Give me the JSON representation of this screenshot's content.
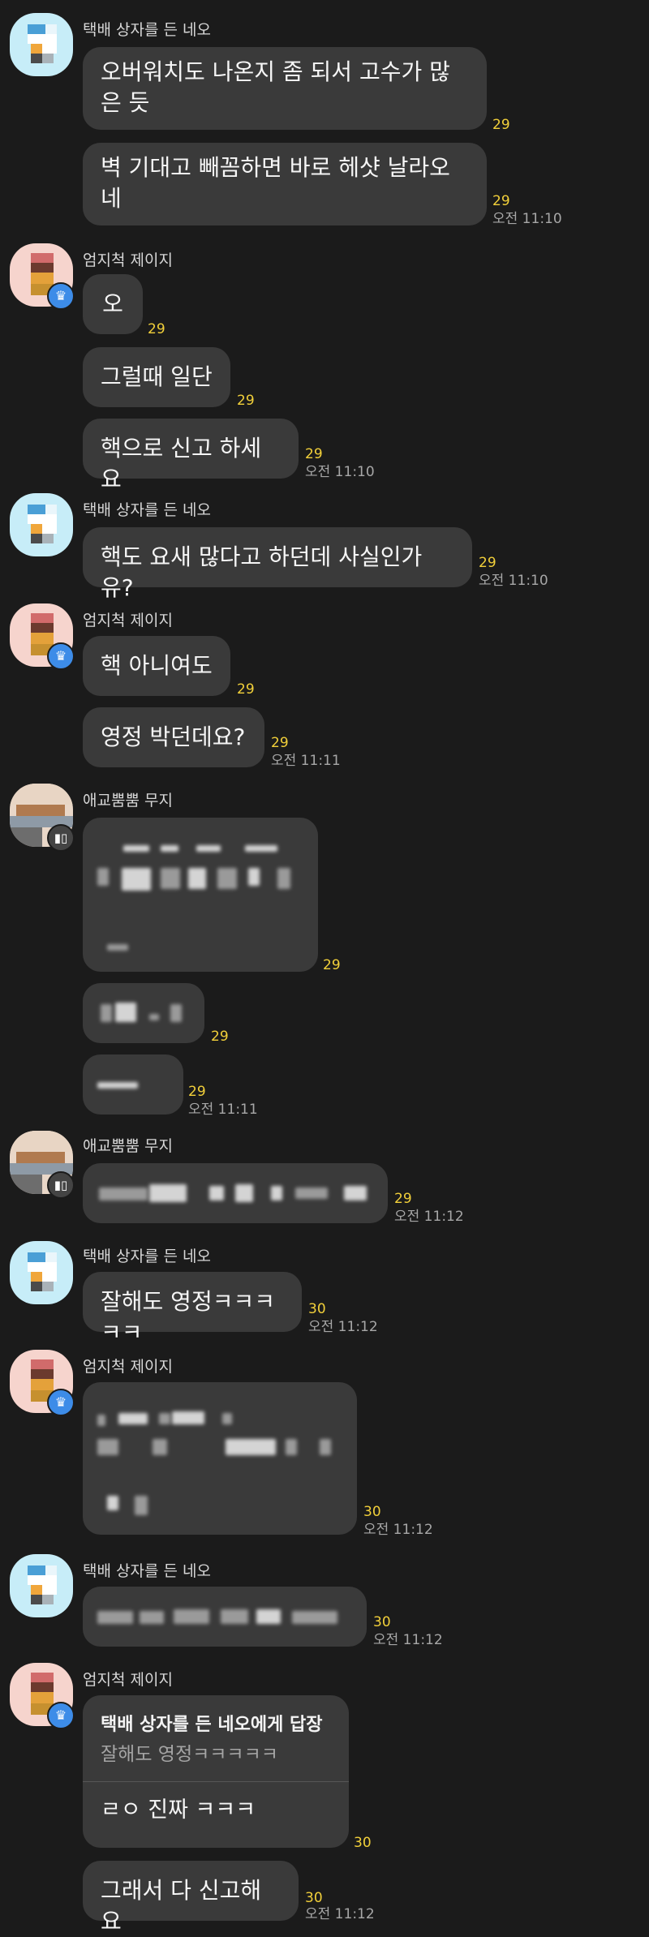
{
  "users": {
    "neo": "택배 상자를 든 네오",
    "jay": "엄지척 제이지",
    "muzi": "애교뿜뿜 무지"
  },
  "messages": [
    {
      "id": "m1",
      "text": "오버워치도 나온지 좀 되서 고수가 많은 듯",
      "count": "29"
    },
    {
      "id": "m2",
      "text": "벽 기대고 빼꼼하면 바로 헤샷 날라오 네",
      "count": "29",
      "time": "오전 11:10"
    },
    {
      "id": "m3",
      "text": "오",
      "count": "29"
    },
    {
      "id": "m4",
      "text": "그럴때 일단",
      "count": "29"
    },
    {
      "id": "m5",
      "text": "핵으로 신고 하세요",
      "count": "29",
      "time": "오전 11:10"
    },
    {
      "id": "m6",
      "text": "핵도 요새 많다고 하던데 사실인가유?",
      "count": "29",
      "time": "오전 11:10"
    },
    {
      "id": "m7",
      "text": "핵 아니여도",
      "count": "29"
    },
    {
      "id": "m8",
      "text": "영정 박던데요?",
      "count": "29",
      "time": "오전 11:11"
    },
    {
      "id": "m9",
      "count": "29"
    },
    {
      "id": "m10",
      "count": "29"
    },
    {
      "id": "m11",
      "count": "29",
      "time": "오전 11:11"
    },
    {
      "id": "m12",
      "count": "29",
      "time": "오전 11:12"
    },
    {
      "id": "m13",
      "text": "잘해도 영정ㅋㅋㅋㅋㅋ",
      "count": "30",
      "time": "오전 11:12"
    },
    {
      "id": "m14",
      "count": "30",
      "time": "오전 11:12"
    },
    {
      "id": "m15",
      "count": "30",
      "time": "오전 11:12"
    },
    {
      "id": "m16",
      "reply_to": "택배 상자를 든 네오에게 답장",
      "quote": "잘해도 영정ㅋㅋㅋㅋㅋ",
      "text": "ㄹㅇ 진짜 ㅋㅋㅋ",
      "count": "30"
    },
    {
      "id": "m17",
      "text": "그래서 다 신고해요",
      "count": "30",
      "time": "오전 11:12"
    }
  ]
}
